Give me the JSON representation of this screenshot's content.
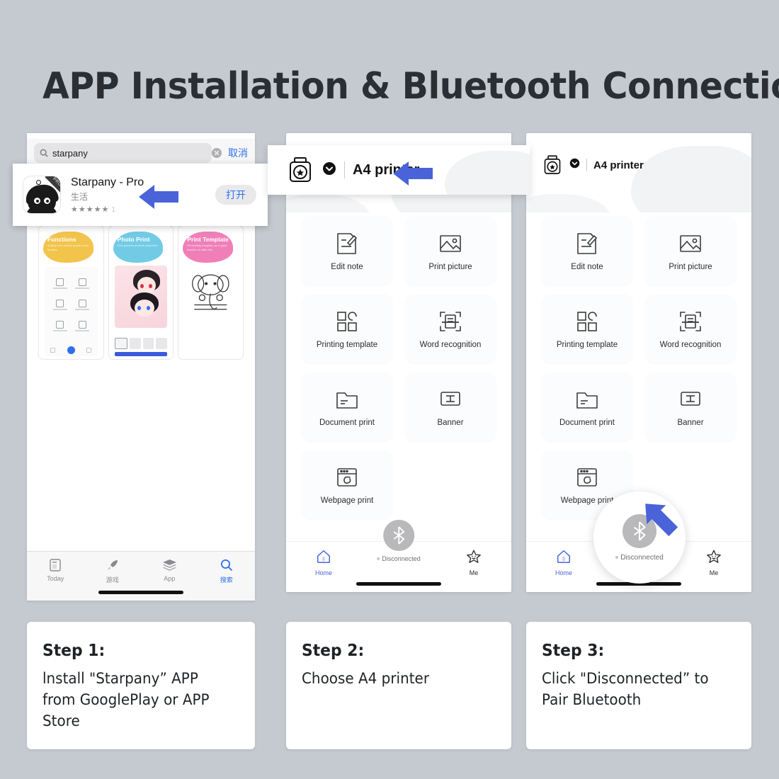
{
  "title": "APP Installation & Bluetooth Connection",
  "colors": {
    "background": "#c5cad0",
    "arrow_blue": "#4a63d8",
    "accent_blue": "#2f6fed",
    "bluetooth_gray": "#b9b9bc",
    "title_text": "#2b2f33"
  },
  "appstore": {
    "search": {
      "value": "starpany",
      "placeholder": "搜索",
      "search_icon": "search-icon",
      "clear_icon": "clear-circle-icon",
      "cancel_label": "取消"
    },
    "result": {
      "name": "Starpany - Pro",
      "category": "生活",
      "stars": "★★★★★",
      "rating_count": "1",
      "open_label": "打开",
      "icon_badge": "PRO"
    },
    "screenshots": [
      {
        "title": "Functions",
        "subtitle": "Multiple and richest simple-touch function"
      },
      {
        "title": "Photo Print",
        "subtitle": "Print pictures anytime anywhere"
      },
      {
        "title": "Print Template",
        "subtitle": "Personality template, as a good teacher of office kits"
      }
    ],
    "tabs": [
      {
        "label": "Today",
        "icon": "today-icon",
        "active": false
      },
      {
        "label": "游戏",
        "icon": "games-rocket-icon",
        "active": false
      },
      {
        "label": "App",
        "icon": "apps-stack-icon",
        "active": false
      },
      {
        "label": "搜索",
        "icon": "search-icon",
        "active": true
      }
    ]
  },
  "printer_app": {
    "header": {
      "printer_icon": "printer-icon",
      "chevron_icon": "chevron-down-circle-icon",
      "device_name": "A4 printer"
    },
    "features": [
      {
        "label": "Edit note",
        "icon": "note-pencil-icon"
      },
      {
        "label": "Print picture",
        "icon": "image-icon"
      },
      {
        "label": "Printing template",
        "icon": "template-grid-icon"
      },
      {
        "label": "Word recognition",
        "icon": "ocr-scan-icon"
      },
      {
        "label": "Document print",
        "icon": "folder-icon"
      },
      {
        "label": "Banner",
        "icon": "banner-text-icon"
      },
      {
        "label": "Webpage print",
        "icon": "browser-icon"
      }
    ],
    "tabbar": {
      "home_label": "Home",
      "home_icon": "home-icon",
      "me_label": "Me",
      "me_icon": "star-face-icon",
      "bluetooth_icon": "bluetooth-icon",
      "bluetooth_status": "Disconnected"
    }
  },
  "steps": [
    {
      "heading": "Step 1:",
      "body": "lnstall \"Starpany” APP from GooglePlay or APP Store"
    },
    {
      "heading": "Step 2:",
      "body": "Choose A4 printer"
    },
    {
      "heading": "Step 3:",
      "body": "Click \"Disconnected” to Pair Bluetooth"
    }
  ]
}
